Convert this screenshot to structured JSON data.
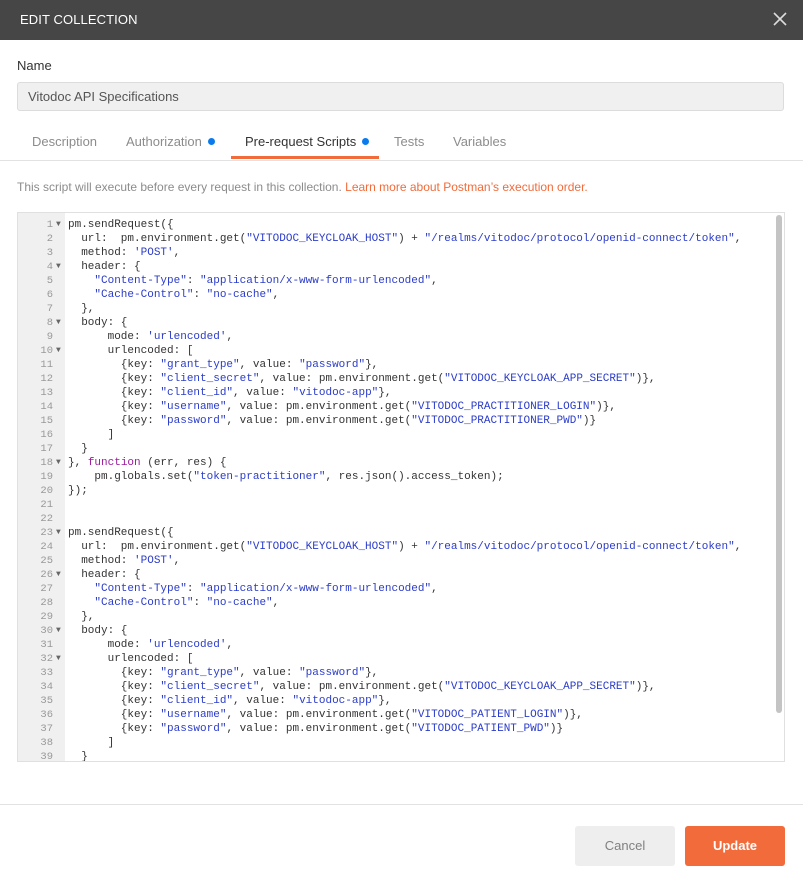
{
  "dialog": {
    "title": "EDIT COLLECTION",
    "close_icon": "close-icon"
  },
  "name_field": {
    "label": "Name",
    "value": "Vitodoc API Specifications"
  },
  "tabs": [
    {
      "label": "Description",
      "dot": false,
      "active": false
    },
    {
      "label": "Authorization",
      "dot": true,
      "active": false
    },
    {
      "label": "Pre-request Scripts",
      "dot": true,
      "active": true
    },
    {
      "label": "Tests",
      "dot": false,
      "active": false
    },
    {
      "label": "Variables",
      "dot": false,
      "active": false
    }
  ],
  "info": {
    "text": "This script will execute before every request in this collection.",
    "link": "Learn more about Postman’s execution order."
  },
  "editor": {
    "lines": [
      {
        "n": "1",
        "fold": true,
        "code": "pm.sendRequest({"
      },
      {
        "n": "2",
        "fold": false,
        "code": "  url:  pm.environment.get(\"VITODOC_KEYCLOAK_HOST\") + \"/realms/vitodoc/protocol/openid-connect/token\","
      },
      {
        "n": "3",
        "fold": false,
        "code": "  method: 'POST',"
      },
      {
        "n": "4",
        "fold": true,
        "code": "  header: {"
      },
      {
        "n": "5",
        "fold": false,
        "code": "    \"Content-Type\": \"application/x-www-form-urlencoded\","
      },
      {
        "n": "6",
        "fold": false,
        "code": "    \"Cache-Control\": \"no-cache\","
      },
      {
        "n": "7",
        "fold": false,
        "code": "  },"
      },
      {
        "n": "8",
        "fold": true,
        "code": "  body: {"
      },
      {
        "n": "9",
        "fold": false,
        "code": "      mode: 'urlencoded',"
      },
      {
        "n": "10",
        "fold": true,
        "code": "      urlencoded: ["
      },
      {
        "n": "11",
        "fold": false,
        "code": "        {key: \"grant_type\", value: \"password\"},"
      },
      {
        "n": "12",
        "fold": false,
        "code": "        {key: \"client_secret\", value: pm.environment.get(\"VITODOC_KEYCLOAK_APP_SECRET\")},"
      },
      {
        "n": "13",
        "fold": false,
        "code": "        {key: \"client_id\", value: \"vitodoc-app\"},"
      },
      {
        "n": "14",
        "fold": false,
        "code": "        {key: \"username\", value: pm.environment.get(\"VITODOC_PRACTITIONER_LOGIN\")},"
      },
      {
        "n": "15",
        "fold": false,
        "code": "        {key: \"password\", value: pm.environment.get(\"VITODOC_PRACTITIONER_PWD\")}"
      },
      {
        "n": "16",
        "fold": false,
        "code": "      ]"
      },
      {
        "n": "17",
        "fold": false,
        "code": "  }"
      },
      {
        "n": "18",
        "fold": true,
        "code": "}, function (err, res) {"
      },
      {
        "n": "19",
        "fold": false,
        "code": "    pm.globals.set(\"token-practitioner\", res.json().access_token);"
      },
      {
        "n": "20",
        "fold": false,
        "code": "});"
      },
      {
        "n": "21",
        "fold": false,
        "code": ""
      },
      {
        "n": "22",
        "fold": false,
        "code": ""
      },
      {
        "n": "23",
        "fold": true,
        "code": "pm.sendRequest({"
      },
      {
        "n": "24",
        "fold": false,
        "code": "  url:  pm.environment.get(\"VITODOC_KEYCLOAK_HOST\") + \"/realms/vitodoc/protocol/openid-connect/token\","
      },
      {
        "n": "25",
        "fold": false,
        "code": "  method: 'POST',"
      },
      {
        "n": "26",
        "fold": true,
        "code": "  header: {"
      },
      {
        "n": "27",
        "fold": false,
        "code": "    \"Content-Type\": \"application/x-www-form-urlencoded\","
      },
      {
        "n": "28",
        "fold": false,
        "code": "    \"Cache-Control\": \"no-cache\","
      },
      {
        "n": "29",
        "fold": false,
        "code": "  },"
      },
      {
        "n": "30",
        "fold": true,
        "code": "  body: {"
      },
      {
        "n": "31",
        "fold": false,
        "code": "      mode: 'urlencoded',"
      },
      {
        "n": "32",
        "fold": true,
        "code": "      urlencoded: ["
      },
      {
        "n": "33",
        "fold": false,
        "code": "        {key: \"grant_type\", value: \"password\"},"
      },
      {
        "n": "34",
        "fold": false,
        "code": "        {key: \"client_secret\", value: pm.environment.get(\"VITODOC_KEYCLOAK_APP_SECRET\")},"
      },
      {
        "n": "35",
        "fold": false,
        "code": "        {key: \"client_id\", value: \"vitodoc-app\"},"
      },
      {
        "n": "36",
        "fold": false,
        "code": "        {key: \"username\", value: pm.environment.get(\"VITODOC_PATIENT_LOGIN\")},"
      },
      {
        "n": "37",
        "fold": false,
        "code": "        {key: \"password\", value: pm.environment.get(\"VITODOC_PATIENT_PWD\")}"
      },
      {
        "n": "38",
        "fold": false,
        "code": "      ]"
      },
      {
        "n": "39",
        "fold": false,
        "code": "  }"
      }
    ]
  },
  "footer": {
    "cancel_label": "Cancel",
    "update_label": "Update"
  },
  "colors": {
    "accent": "#f26b3a",
    "dot": "#097bed",
    "titlebar": "#464646"
  }
}
